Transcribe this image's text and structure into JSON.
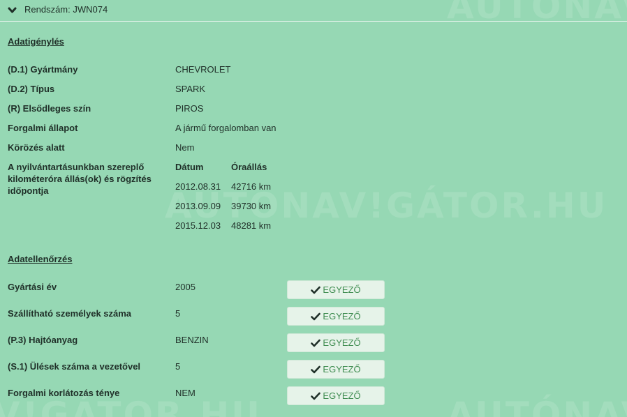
{
  "watermark": {
    "mid": "AUTÓNAV!GÁTOR.HU",
    "top": "AUTÓNAV!GÁ",
    "bottom_left": "V!GÁTOR.HU",
    "bottom_right": "AUTÓNAV!G"
  },
  "header": {
    "label": "Rendszám: JWN074"
  },
  "adatigenyles": {
    "title": "Adatigénylés",
    "rows": [
      {
        "label": "(D.1) Gyártmány",
        "value": "CHEVROLET"
      },
      {
        "label": "(D.2) Típus",
        "value": "SPARK"
      },
      {
        "label": "(R) Elsődleges szín",
        "value": "PIROS"
      },
      {
        "label": "Forgalmi állapot",
        "value": "A jármű forgalomban van"
      },
      {
        "label": "Körözés alatt",
        "value": "Nem"
      }
    ],
    "odometer": {
      "label": "A nyilvántartásunkban szereplő kilométeróra állás(ok) és rögzítés időpontja",
      "col_date": "Dátum",
      "col_reading": "Óraállás",
      "entries": [
        {
          "date": "2012.08.31",
          "reading": "42716 km"
        },
        {
          "date": "2013.09.09",
          "reading": "39730 km"
        },
        {
          "date": "2015.12.03",
          "reading": "48281 km"
        }
      ]
    }
  },
  "adatellenorzes": {
    "title": "Adatellenőrzés",
    "rows": [
      {
        "label": "Gyártási év",
        "value": "2005",
        "status": "EGYEZŐ"
      },
      {
        "label": "Szállítható személyek száma",
        "value": "5",
        "status": "EGYEZŐ"
      },
      {
        "label": "(P.3) Hajtóanyag",
        "value": "BENZIN",
        "status": "EGYEZŐ"
      },
      {
        "label": "(S.1) Ülések száma a vezetővel",
        "value": "5",
        "status": "EGYEZŐ"
      },
      {
        "label": "Forgalmi korlátozás ténye",
        "value": "NEM",
        "status": "EGYEZŐ"
      }
    ]
  },
  "colors": {
    "background": "#96d8b4",
    "badge_bg": "#e6f3e9",
    "badge_text": "#3d8b4f"
  }
}
